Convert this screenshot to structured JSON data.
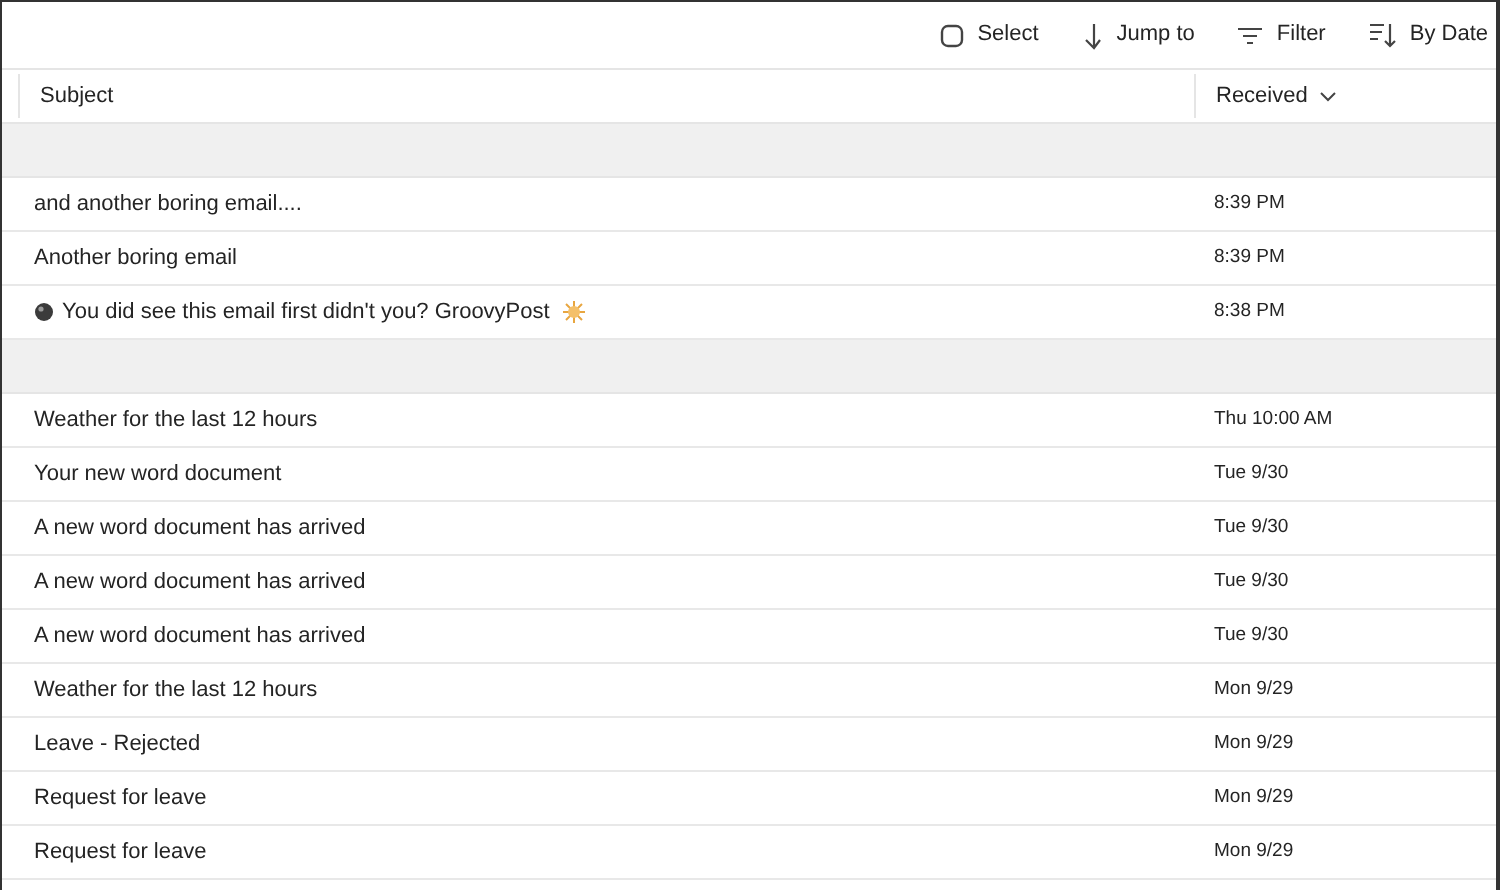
{
  "toolbar": [
    {
      "kind": "select",
      "label": "Select"
    },
    {
      "kind": "jump",
      "label": "Jump to"
    },
    {
      "kind": "filter",
      "label": "Filter"
    },
    {
      "kind": "sort",
      "label": "By Date"
    }
  ],
  "columns": [
    {
      "label": "Subject",
      "caret": false
    },
    {
      "label": "Received",
      "caret": true
    }
  ],
  "groups": [
    {
      "rows": [
        {
          "kind": "plain",
          "subject": "and another boring email....",
          "received": "8:39 PM"
        },
        {
          "kind": "plain",
          "subject": "Another boring email",
          "received": "8:39 PM"
        },
        {
          "kind": "decorated",
          "subject": "You did see this email first didn't you? GroovyPost",
          "received": "8:38 PM"
        }
      ]
    },
    {
      "rows": [
        {
          "kind": "plain",
          "subject": "Weather for the last 12 hours",
          "received": "Thu 10:00 AM"
        },
        {
          "kind": "plain",
          "subject": "Your new word document",
          "received": "Tue 9/30"
        },
        {
          "kind": "plain",
          "subject": "A new word document has arrived",
          "received": "Tue 9/30"
        },
        {
          "kind": "plain",
          "subject": "A new word document has arrived",
          "received": "Tue 9/30"
        },
        {
          "kind": "plain",
          "subject": "A new word document has arrived",
          "received": "Tue 9/30"
        },
        {
          "kind": "plain",
          "subject": "Weather for the last 12 hours",
          "received": "Mon 9/29"
        },
        {
          "kind": "plain",
          "subject": "Leave - Rejected",
          "received": "Mon 9/29"
        },
        {
          "kind": "plain",
          "subject": "Request for leave",
          "received": "Mon 9/29"
        },
        {
          "kind": "plain",
          "subject": "Request for leave",
          "received": "Mon 9/29"
        }
      ]
    }
  ]
}
